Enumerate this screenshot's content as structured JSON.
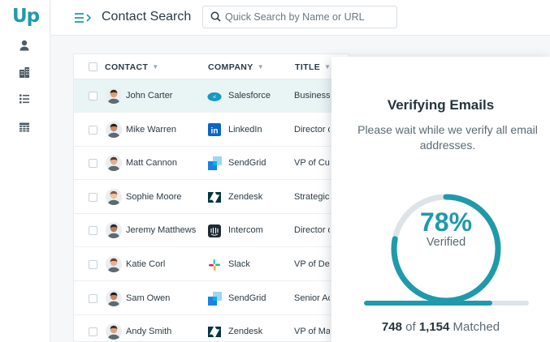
{
  "app": {
    "logo": "Up"
  },
  "header": {
    "title": "Contact Search",
    "search_placeholder": "Quick Search by Name or URL"
  },
  "table": {
    "columns": [
      "CONTACT",
      "COMPANY",
      "TITLE"
    ],
    "rows": [
      {
        "name": "John Carter",
        "company": "Salesforce",
        "title": "Business Development",
        "logo": "salesforce-logo",
        "selected": true
      },
      {
        "name": "Mike Warren",
        "company": "LinkedIn",
        "title": "Director of Sales",
        "logo": "linkedin-logo"
      },
      {
        "name": "Matt Cannon",
        "company": "SendGrid",
        "title": "VP of Customer Success",
        "logo": "sendgrid-logo"
      },
      {
        "name": "Sophie Moore",
        "company": "Zendesk",
        "title": "Strategic Accounts",
        "logo": "zendesk-logo"
      },
      {
        "name": "Jeremy Matthews",
        "company": "Intercom",
        "title": "Director of Marketing",
        "logo": "intercom-logo"
      },
      {
        "name": "Katie Corl",
        "company": "Slack",
        "title": "VP of Design",
        "logo": "slack-logo"
      },
      {
        "name": "Sam Owen",
        "company": "SendGrid",
        "title": "Senior Account Executive",
        "logo": "sendgrid-logo"
      },
      {
        "name": "Andy Smith",
        "company": "Zendesk",
        "title": "VP of Marketing",
        "logo": "zendesk-logo"
      }
    ]
  },
  "modal": {
    "title": "Verifying Emails",
    "message": "Please wait while we verify all email addresses.",
    "percent_label": "78%",
    "progress": 0.78,
    "status_label": "Verified",
    "matched_count": "748",
    "matched_of": "of",
    "matched_total": "1,154",
    "matched_label": "Matched"
  },
  "colors": {
    "accent": "#1f9aab",
    "track": "#dde4e8"
  }
}
